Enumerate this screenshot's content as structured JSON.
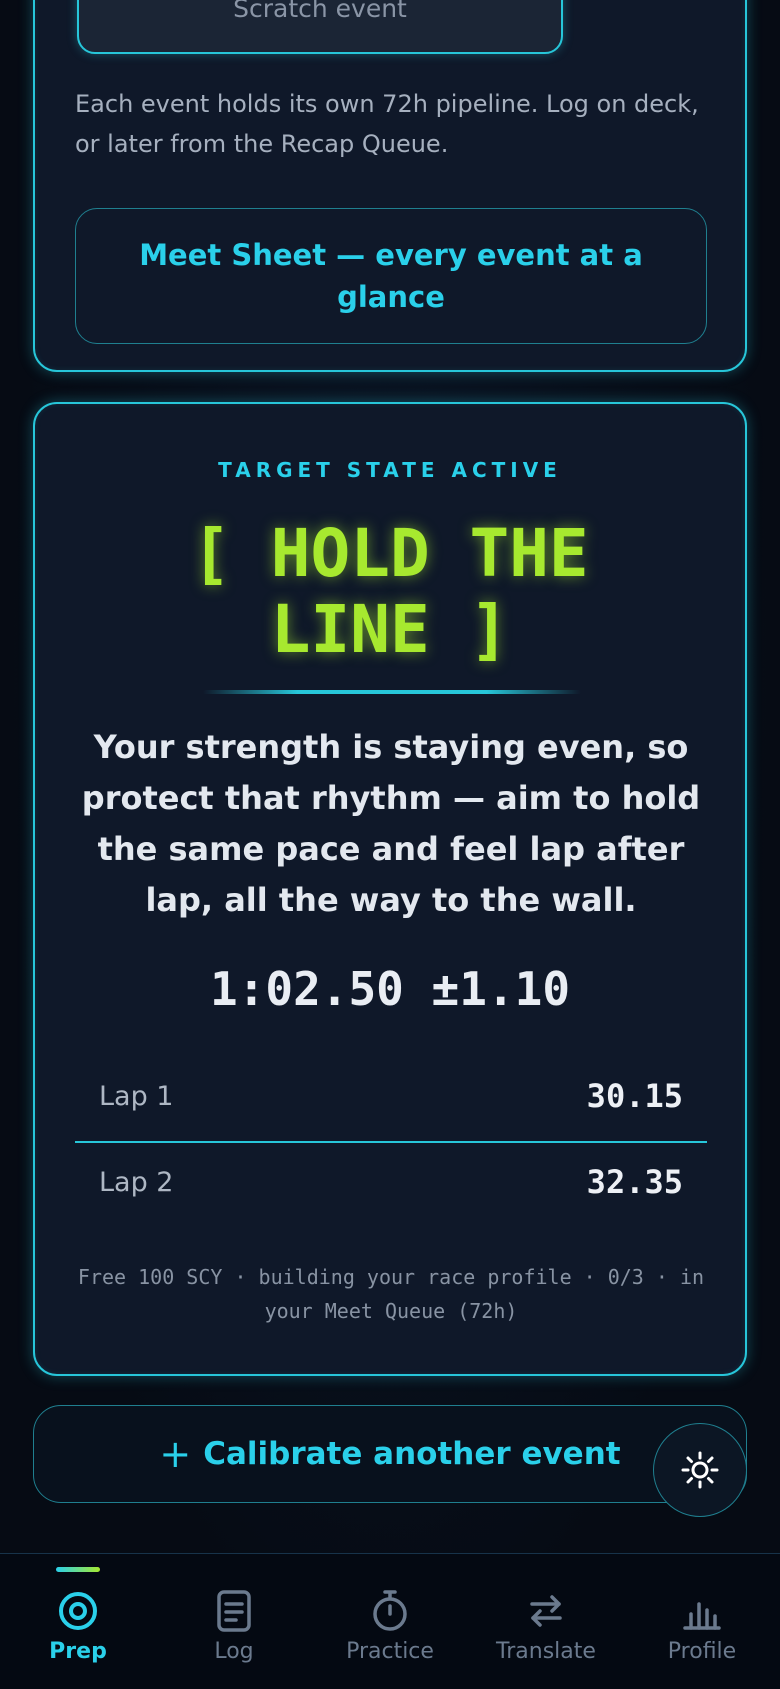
{
  "event_card": {
    "scratch_label": "Scratch event",
    "pipeline_note": "Each event holds its own 72h pipeline. Log on deck, or later from the Recap Queue.",
    "meet_sheet_label": "Meet Sheet — every event at a glance"
  },
  "target_card": {
    "eyebrow": "TARGET STATE ACTIVE",
    "headline_line1": "[ HOLD THE",
    "headline_line2": "LINE ]",
    "strategy": "Your strength is staying even, so protect that rhythm — aim to hold the same pace and feel lap after lap, all the way to the wall.",
    "target_time": "1:02.50 ±1.10",
    "laps": [
      {
        "label": "Lap 1",
        "split": "30.15"
      },
      {
        "label": "Lap 2",
        "split": "32.35"
      }
    ],
    "profile_note": "Free 100 SCY · building your race profile · 0/3 · in your Meet Queue (72h)"
  },
  "calibrate": {
    "plus": "+",
    "label": "Calibrate another event"
  },
  "theme_toggle": {
    "icon": "sun-icon"
  },
  "nav": {
    "active_index": 0,
    "items": [
      {
        "label": "Prep",
        "icon": "target-icon"
      },
      {
        "label": "Log",
        "icon": "document-icon"
      },
      {
        "label": "Practice",
        "icon": "stopwatch-icon"
      },
      {
        "label": "Translate",
        "icon": "swap-arrows-icon"
      },
      {
        "label": "Profile",
        "icon": "bar-chart-icon"
      }
    ]
  },
  "colors": {
    "accent": "#2ad0ea",
    "highlight": "#a7e92f",
    "card_bg": "#0f1829",
    "page_bg": "#070d17"
  }
}
